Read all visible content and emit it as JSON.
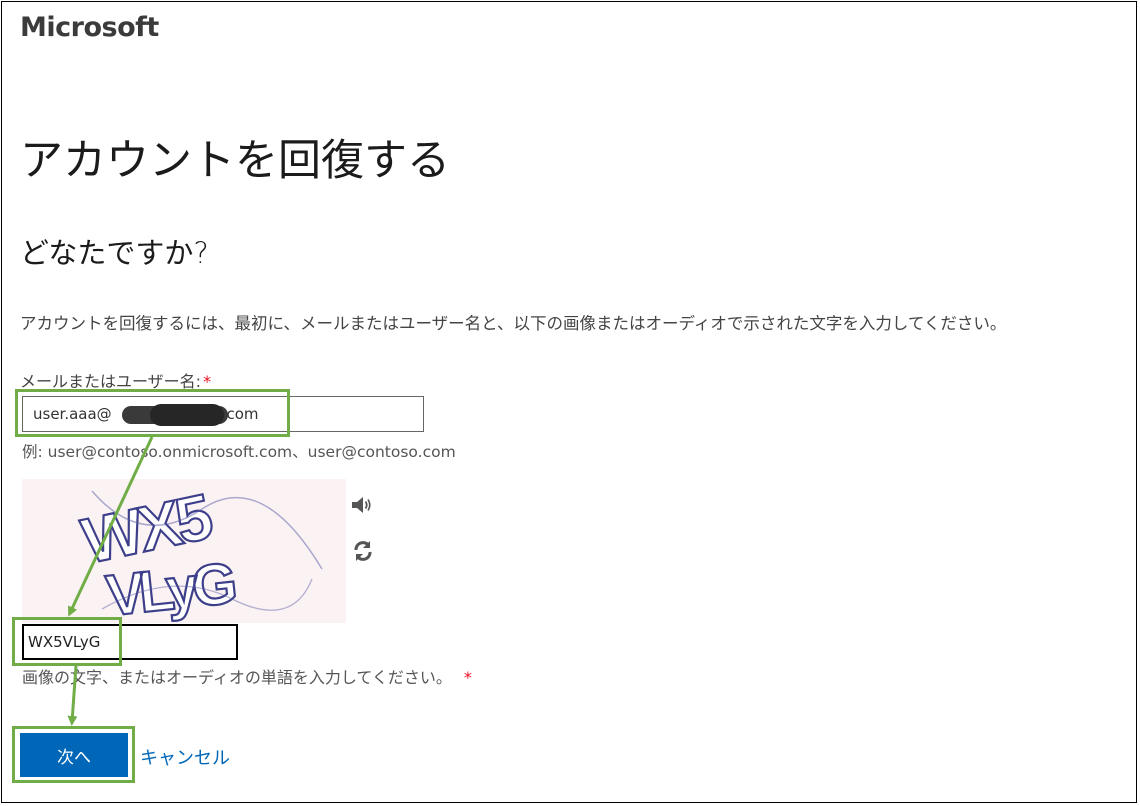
{
  "header": {
    "logo_text": "Microsoft"
  },
  "main": {
    "title": "アカウントを回復する",
    "subtitle": "どなたですか?",
    "description": "アカウントを回復するには、最初に、メールまたはユーザー名と、以下の画像またはオーディオで示された文字を入力してください。"
  },
  "email": {
    "label": "メールまたはユーザー名:",
    "required_mark": "*",
    "value": "user.aaa@",
    "value_suffix": ".com",
    "example": "例: user@contoso.onmicrosoft.com、user@contoso.com"
  },
  "captcha": {
    "image_text_line1": "WX5",
    "image_text_line2": "VLyG",
    "audio_icon": "speaker-icon",
    "refresh_icon": "refresh-icon",
    "input_value": "WX5VLyG",
    "hint": "画像の文字、またはオーディオの単語を入力してください。",
    "required_mark": "*"
  },
  "actions": {
    "next_label": "次へ",
    "cancel_label": "キャンセル"
  },
  "colors": {
    "primary": "#0067b8",
    "highlight": "#70ad47",
    "required": "#e81123"
  }
}
